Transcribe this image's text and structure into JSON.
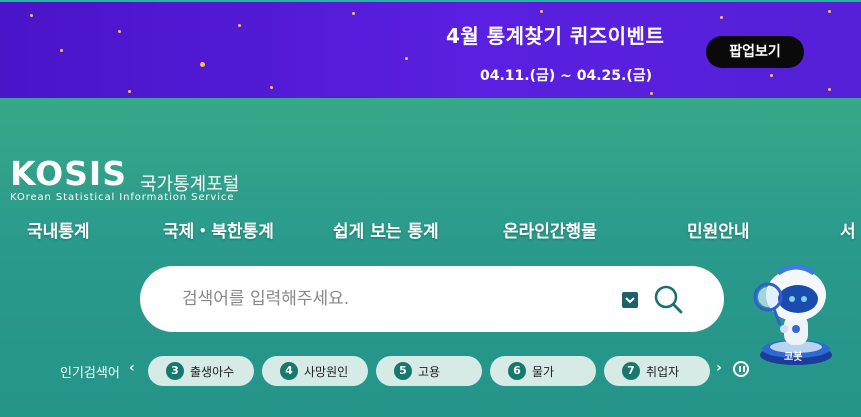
{
  "banner": {
    "title": "4월 통계찾기 퀴즈이벤트",
    "date": "04.11.(금) ~ 04.25.(금)",
    "popup_button": "팝업보기"
  },
  "logo": {
    "name": "KOSIS",
    "korean": "국가통계포털",
    "subtitle": "KOrean Statistical Information Service"
  },
  "nav": {
    "items": [
      "국내통계",
      "국제・북한통계",
      "쉽게 보는 통계",
      "온라인간행물",
      "민원안내",
      "서"
    ]
  },
  "search": {
    "placeholder": "검색어를 입력해주세요.",
    "icons": [
      "chevron-down-icon",
      "search-icon"
    ]
  },
  "popular": {
    "label": "인기검색어",
    "items": [
      {
        "rank": "3",
        "term": "출생아수"
      },
      {
        "rank": "4",
        "term": "사망원인"
      },
      {
        "rank": "5",
        "term": "고용"
      },
      {
        "rank": "6",
        "term": "물가"
      },
      {
        "rank": "7",
        "term": "취업자"
      }
    ]
  },
  "mascot": {
    "name": "코봇"
  },
  "colors": {
    "banner": "#5a1fe0",
    "main": "#2a9a8c",
    "pill": "#d6ebe6",
    "rank": "#17786e"
  }
}
